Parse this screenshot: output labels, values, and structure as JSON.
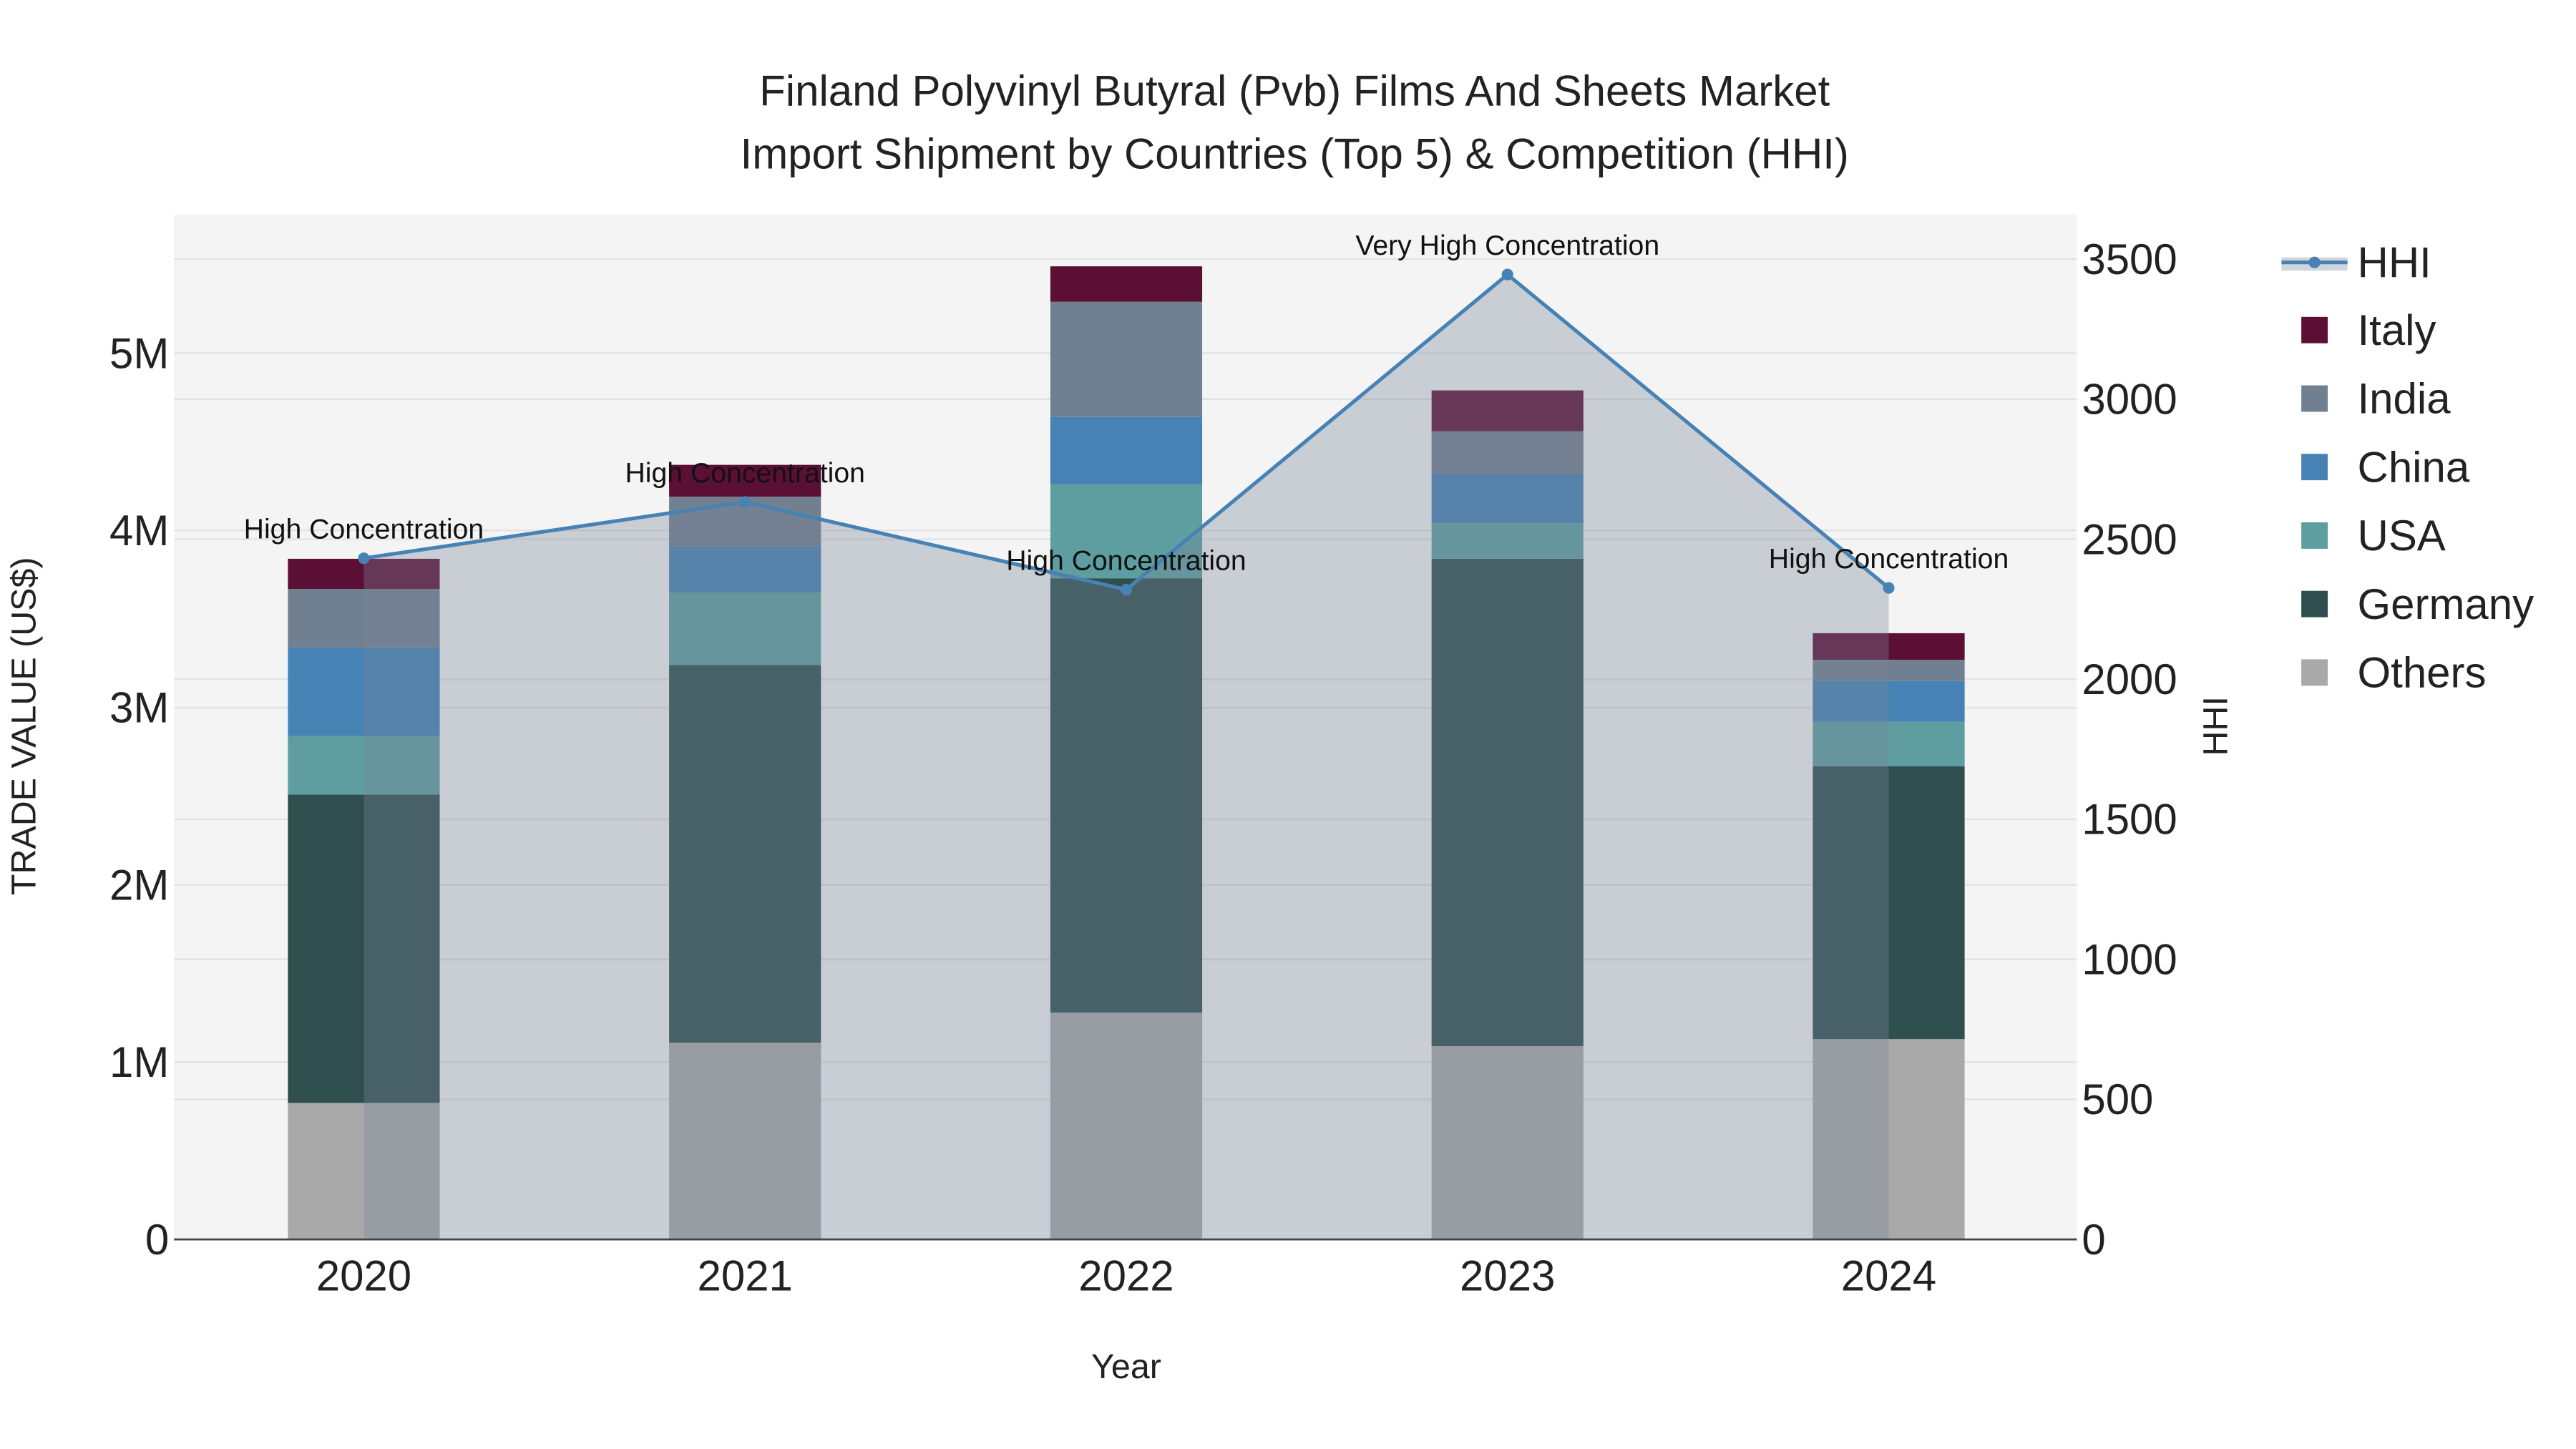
{
  "chart_data": {
    "type": "bar",
    "title_line1": "Finland Polyvinyl Butyral (Pvb) Films And Sheets Market",
    "title_line2": "Import Shipment by Countries (Top 5) & Competition (HHI)",
    "xlabel": "Year",
    "ylabel": "TRADE VALUE (US$)",
    "y2label": "HHI",
    "categories": [
      "2020",
      "2021",
      "2022",
      "2023",
      "2024"
    ],
    "ylim": [
      0,
      5650000
    ],
    "y2lim": [
      0,
      3650
    ],
    "yticks": [
      0,
      1000000,
      2000000,
      3000000,
      4000000,
      5000000
    ],
    "ytick_labels": [
      "0",
      "1M",
      "2M",
      "3M",
      "4M",
      "5M"
    ],
    "y2ticks": [
      0,
      500,
      1000,
      1500,
      2000,
      2500,
      3000,
      3500
    ],
    "y2tick_labels": [
      "0",
      "500",
      "1000",
      "1500",
      "2000",
      "2500",
      "3000",
      "3500"
    ],
    "series": [
      {
        "name": "Others",
        "color": "#a9a9a9",
        "values": [
          770000,
          1110000,
          1280000,
          1090000,
          1130000
        ]
      },
      {
        "name": "Germany",
        "color": "#2f4f4f",
        "values": [
          1740000,
          2130000,
          2450000,
          2750000,
          1540000
        ]
      },
      {
        "name": "USA",
        "color": "#5f9ea0",
        "values": [
          330000,
          410000,
          530000,
          200000,
          250000
        ]
      },
      {
        "name": "China",
        "color": "#4682b4",
        "values": [
          500000,
          260000,
          380000,
          280000,
          230000
        ]
      },
      {
        "name": "India",
        "color": "#708090",
        "values": [
          330000,
          280000,
          650000,
          240000,
          120000
        ]
      },
      {
        "name": "Italy",
        "color": "#5c0f35",
        "values": [
          170000,
          180000,
          200000,
          230000,
          150000
        ]
      }
    ],
    "hhi": {
      "name": "HHI",
      "color": "#4682b4",
      "values": [
        2432,
        2633,
        2320,
        3445,
        2326
      ],
      "annotations": [
        "High Concentration",
        "High Concentration",
        "High Concentration",
        "Very High Concentration",
        "High Concentration"
      ]
    },
    "legend_order": [
      "HHI",
      "Italy",
      "India",
      "China",
      "USA",
      "Germany",
      "Others"
    ],
    "legend_position": "right",
    "grid": true
  }
}
